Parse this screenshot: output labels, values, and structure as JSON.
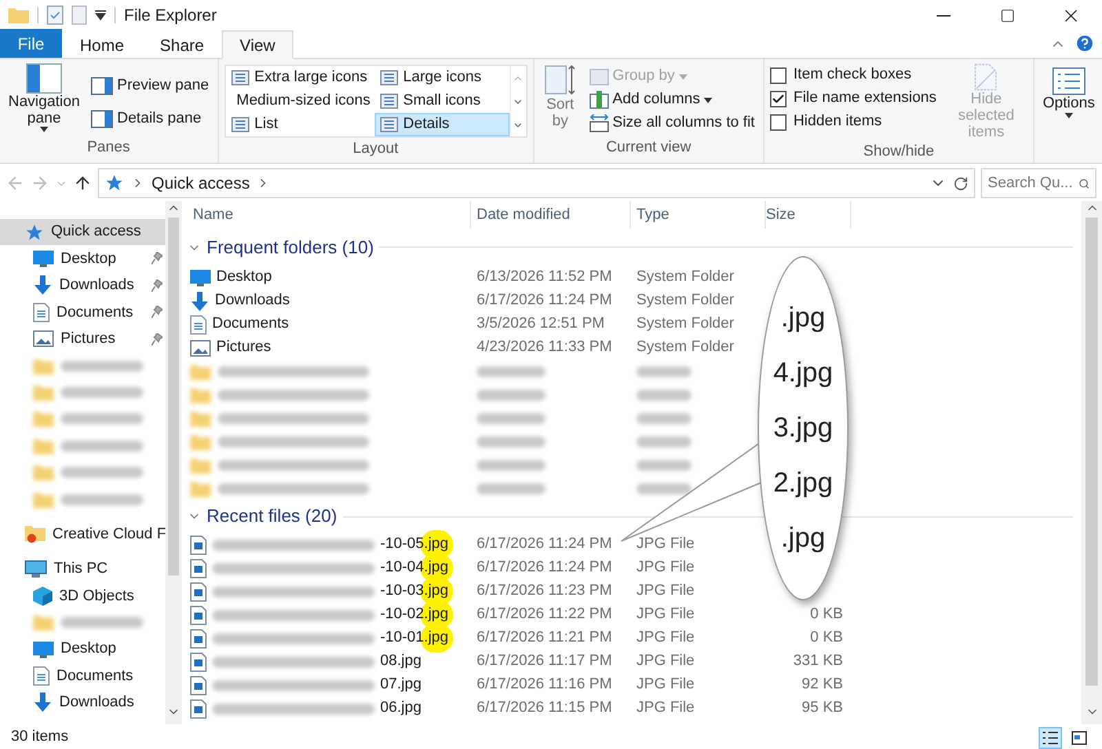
{
  "window": {
    "title": "File Explorer"
  },
  "tabs": [
    {
      "label": "File",
      "kind": "file",
      "selected": false
    },
    {
      "label": "Home",
      "kind": "tab",
      "selected": false
    },
    {
      "label": "Share",
      "kind": "tab",
      "selected": false
    },
    {
      "label": "View",
      "kind": "tab",
      "selected": true
    }
  ],
  "ribbon": {
    "panes": {
      "label": "Panes",
      "navigation_pane": "Navigation pane",
      "preview_pane": "Preview pane",
      "details_pane": "Details pane"
    },
    "layout": {
      "label": "Layout",
      "options": [
        {
          "label": "Extra large icons",
          "selected": false
        },
        {
          "label": "Large icons",
          "selected": false
        },
        {
          "label": "Medium-sized icons",
          "selected": false
        },
        {
          "label": "Small icons",
          "selected": false
        },
        {
          "label": "List",
          "selected": false
        },
        {
          "label": "Details",
          "selected": true
        }
      ]
    },
    "current_view": {
      "label": "Current view",
      "sort_by": "Sort by",
      "group_by": {
        "label": "Group by",
        "disabled": true
      },
      "add_columns": "Add columns",
      "size_columns": "Size all columns to fit"
    },
    "show_hide": {
      "label": "Show/hide",
      "checkboxes": [
        {
          "label": "Item check boxes",
          "checked": false
        },
        {
          "label": "File name extensions",
          "checked": true
        },
        {
          "label": "Hidden items",
          "checked": false
        }
      ],
      "hide_selected": {
        "label": "Hide selected items",
        "disabled": true
      }
    },
    "options": "Options"
  },
  "address": {
    "path": "Quick access",
    "search_placeholder": "Search Qu..."
  },
  "sidebar": {
    "items": [
      {
        "label": "Quick access",
        "kind": "quick_access",
        "selected": true,
        "children": [
          {
            "label": "Desktop",
            "kind": "desktop",
            "pinned": true,
            "selected": false
          },
          {
            "label": "Downloads",
            "kind": "downloads",
            "pinned": true,
            "selected": false
          },
          {
            "label": "Documents",
            "kind": "documents",
            "pinned": true,
            "selected": false
          },
          {
            "label": "Pictures",
            "kind": "pictures",
            "pinned": true,
            "selected": false
          },
          {
            "kind": "blurred",
            "selected": false
          },
          {
            "kind": "blurred",
            "selected": false
          },
          {
            "kind": "blurred",
            "selected": false
          },
          {
            "kind": "blurred",
            "selected": false
          },
          {
            "kind": "blurred",
            "selected": false
          },
          {
            "kind": "blurred",
            "selected": false
          }
        ]
      },
      {
        "label": "Creative Cloud F",
        "kind": "cloud",
        "selected": false
      },
      {
        "label": "This PC",
        "kind": "pc",
        "selected": false,
        "children": [
          {
            "label": "3D Objects",
            "kind": "objects3d",
            "pinned": false,
            "selected": false
          },
          {
            "kind": "blurred",
            "selected": false
          },
          {
            "label": "Desktop",
            "kind": "desktop",
            "pinned": false,
            "selected": false
          },
          {
            "label": "Documents",
            "kind": "documents",
            "pinned": false,
            "selected": false
          },
          {
            "label": "Downloads",
            "kind": "downloads",
            "pinned": false,
            "selected": false
          }
        ]
      }
    ]
  },
  "columns": [
    "Name",
    "Date modified",
    "Type",
    "Size"
  ],
  "groups": [
    {
      "title": "Frequent folders (10)",
      "expanded": true,
      "rows": [
        {
          "kind": "desktop",
          "name": "Desktop",
          "date": "6/13/2026 11:52 PM",
          "type": "System Folder"
        },
        {
          "kind": "downloads",
          "name": "Downloads",
          "date": "6/17/2026 11:24 PM",
          "type": "System Folder"
        },
        {
          "kind": "documents",
          "name": "Documents",
          "date": "3/5/2026 12:51 PM",
          "type": "System Folder"
        },
        {
          "kind": "pictures",
          "name": "Pictures",
          "date": "4/23/2026 11:33 PM",
          "type": "System Folder"
        },
        {
          "kind": "blurred"
        },
        {
          "kind": "blurred"
        },
        {
          "kind": "blurred"
        },
        {
          "kind": "blurred"
        },
        {
          "kind": "blurred"
        },
        {
          "kind": "blurred"
        }
      ]
    },
    {
      "title": "Recent files (20)",
      "expanded": true,
      "rows": [
        {
          "kind": "jpg",
          "name": "-10-05.jpg",
          "highlighted": true,
          "date": "6/17/2026 11:24 PM",
          "type": "JPG File"
        },
        {
          "kind": "jpg",
          "name": "-10-04.jpg",
          "highlighted": true,
          "date": "6/17/2026 11:24 PM",
          "type": "JPG File"
        },
        {
          "kind": "jpg",
          "name": "-10-03.jpg",
          "highlighted": true,
          "date": "6/17/2026 11:23 PM",
          "type": "JPG File"
        },
        {
          "kind": "jpg",
          "name": "-10-02.jpg",
          "highlighted": true,
          "date": "6/17/2026 11:22 PM",
          "type": "JPG File",
          "size": "0 KB"
        },
        {
          "kind": "jpg",
          "name": "-10-01.jpg",
          "highlighted": true,
          "date": "6/17/2026 11:21 PM",
          "type": "JPG File",
          "size": "0 KB"
        },
        {
          "kind": "jpg",
          "name": "08.jpg",
          "highlighted": false,
          "date": "6/17/2026 11:17 PM",
          "type": "JPG File",
          "size": "331 KB"
        },
        {
          "kind": "jpg",
          "name": "07.jpg",
          "highlighted": false,
          "date": "6/17/2026 11:16 PM",
          "type": "JPG File",
          "size": "92 KB"
        },
        {
          "kind": "jpg",
          "name": "06.jpg",
          "highlighted": false,
          "date": "6/17/2026 11:15 PM",
          "type": "JPG File",
          "size": "95 KB"
        }
      ]
    }
  ],
  "callout": {
    "lines": [
      ".jpg",
      "4.jpg",
      "3.jpg",
      "2.jpg",
      ".jpg"
    ]
  },
  "status_bar": {
    "count": "30 items",
    "view_buttons": [
      {
        "kind": "details",
        "selected": true
      },
      {
        "kind": "large",
        "selected": false
      }
    ]
  }
}
